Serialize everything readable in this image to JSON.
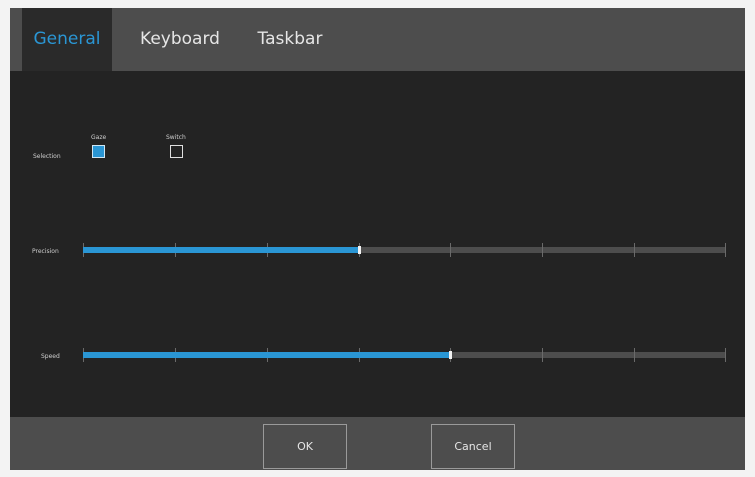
{
  "tabs": [
    {
      "label": "General",
      "active": true
    },
    {
      "label": "Keyboard",
      "active": false
    },
    {
      "label": "Taskbar",
      "active": false
    }
  ],
  "selection": {
    "label": "Selection",
    "options": [
      {
        "label": "Gaze",
        "checked": true
      },
      {
        "label": "Switch",
        "checked": false
      }
    ]
  },
  "precision": {
    "label": "Precision",
    "value_fraction": 0.43,
    "tick_count": 8
  },
  "speed": {
    "label": "Speed",
    "value_fraction": 0.57,
    "tick_count": 8
  },
  "footer": {
    "ok_label": "OK",
    "cancel_label": "Cancel"
  },
  "colors": {
    "accent": "#2a96d4",
    "background": "#232323",
    "bar": "#4d4d4d"
  }
}
